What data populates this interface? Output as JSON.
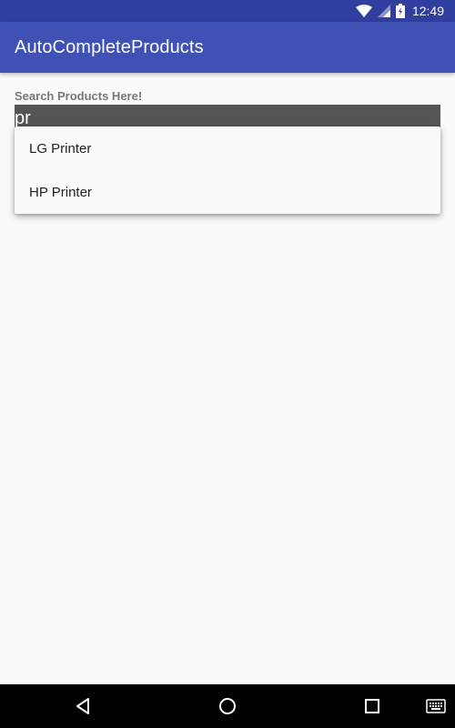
{
  "status_bar": {
    "time": "12:49",
    "icons": [
      "wifi-icon",
      "cell-signal-icon",
      "battery-icon"
    ]
  },
  "app_bar": {
    "title": "AutoCompleteProducts",
    "color": "#3f51b5",
    "status_color": "#303f9f"
  },
  "search": {
    "label": "Search Products Here!",
    "value": "pr",
    "suggestions": [
      "LG Printer",
      "HP Printer"
    ]
  },
  "nav_bar": {
    "buttons": [
      "back-icon",
      "home-icon",
      "recents-icon",
      "keyboard-icon"
    ]
  }
}
